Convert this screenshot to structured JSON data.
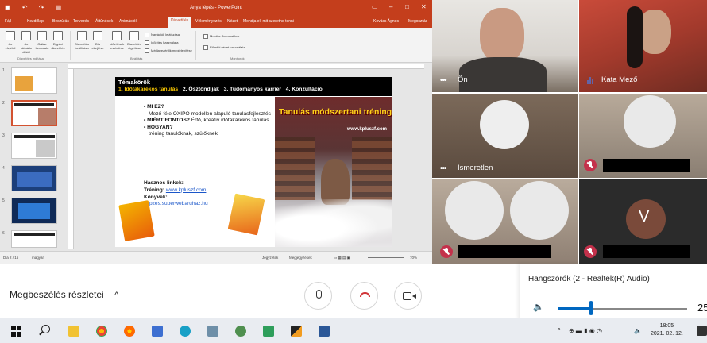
{
  "powerpoint": {
    "window_title": "Anya lépés - PowerPoint",
    "tabs": [
      "Fájl",
      "Kezdőlap",
      "Beszúrás",
      "Tervezés",
      "Áttűnések",
      "Animációk",
      "Diavetítés",
      "Véleményezés",
      "Nézet",
      "Mondja el, mit szeretne tenni"
    ],
    "active_tab": "Diavetítés",
    "account": "Kovács Ágnes",
    "share": "Megosztás",
    "ribbon": {
      "buttons": [
        "Az elejétől",
        "Az aktuális diától",
        "Online bemutató",
        "Egyéni diavetítés",
        "Diavetítés beállítása",
        "Dia elrejtése",
        "Időzítések tesztelése",
        "Diavetítés rögzítése"
      ],
      "checks": [
        "Narrációk lejátszása",
        "Időzítés használata",
        "Médiavezérlők megjelenítése"
      ],
      "monitor_label": "Monitor: Automatikus",
      "presenter_view": "Előadói nézet használata",
      "groups": [
        "Diavetítés indítása",
        "Beállítás",
        "Monitorok"
      ]
    },
    "thumbnails": [
      {
        "num": "1",
        "dark": false
      },
      {
        "num": "2",
        "dark": false,
        "selected": true
      },
      {
        "num": "3",
        "dark": false
      },
      {
        "num": "4",
        "dark": true
      },
      {
        "num": "5",
        "dark": true
      },
      {
        "num": "6",
        "dark": false
      }
    ],
    "status_left": "Dia 2 / 15",
    "status_lang": "magyar",
    "status_notes": "Jegyzetek",
    "status_comments": "Megjegyzések",
    "status_zoom": "70%"
  },
  "slide": {
    "heading": "Témakörök",
    "nav": [
      "1. Időtakarékos tanulás",
      "2. Ösztöndíjak",
      "3. Tudományos karrier",
      "4. Konzultáció"
    ],
    "bullets": [
      {
        "title": "MI EZ?",
        "text": "Mező-féle OXIPO modellen alapuló tanulásfejlesztés"
      },
      {
        "title": "MIÉRT FONTOS?",
        "text": "Értő, kreatív időtakarékos tanulás."
      },
      {
        "title": "HOGYAN?",
        "text": "tréning tanulóknak, szülőknek"
      }
    ],
    "links_heading": "Hasznos linkek:",
    "training_label": "Tréning:",
    "training_url": "www.kpluszf.com",
    "books_label": "Könyvek:",
    "books_url": "kepzes.superwebaruhaz.hu",
    "image_title": "Tanulás módszertani tréning",
    "image_url": "www.kpluszf.com"
  },
  "participants": {
    "self": "Ön",
    "speaker": "Kata Mező",
    "unknown": "Ismeretlen",
    "avatar_letter": "V"
  },
  "controls": {
    "meeting_details": "Megbeszélés részletei",
    "chevron": "^"
  },
  "volume": {
    "device": "Hangszórók (2 - Realtek(R) Audio)",
    "level": 25,
    "level_text": "25"
  },
  "taskbar": {
    "time": "18:05",
    "date": "2021. 02. 12."
  }
}
